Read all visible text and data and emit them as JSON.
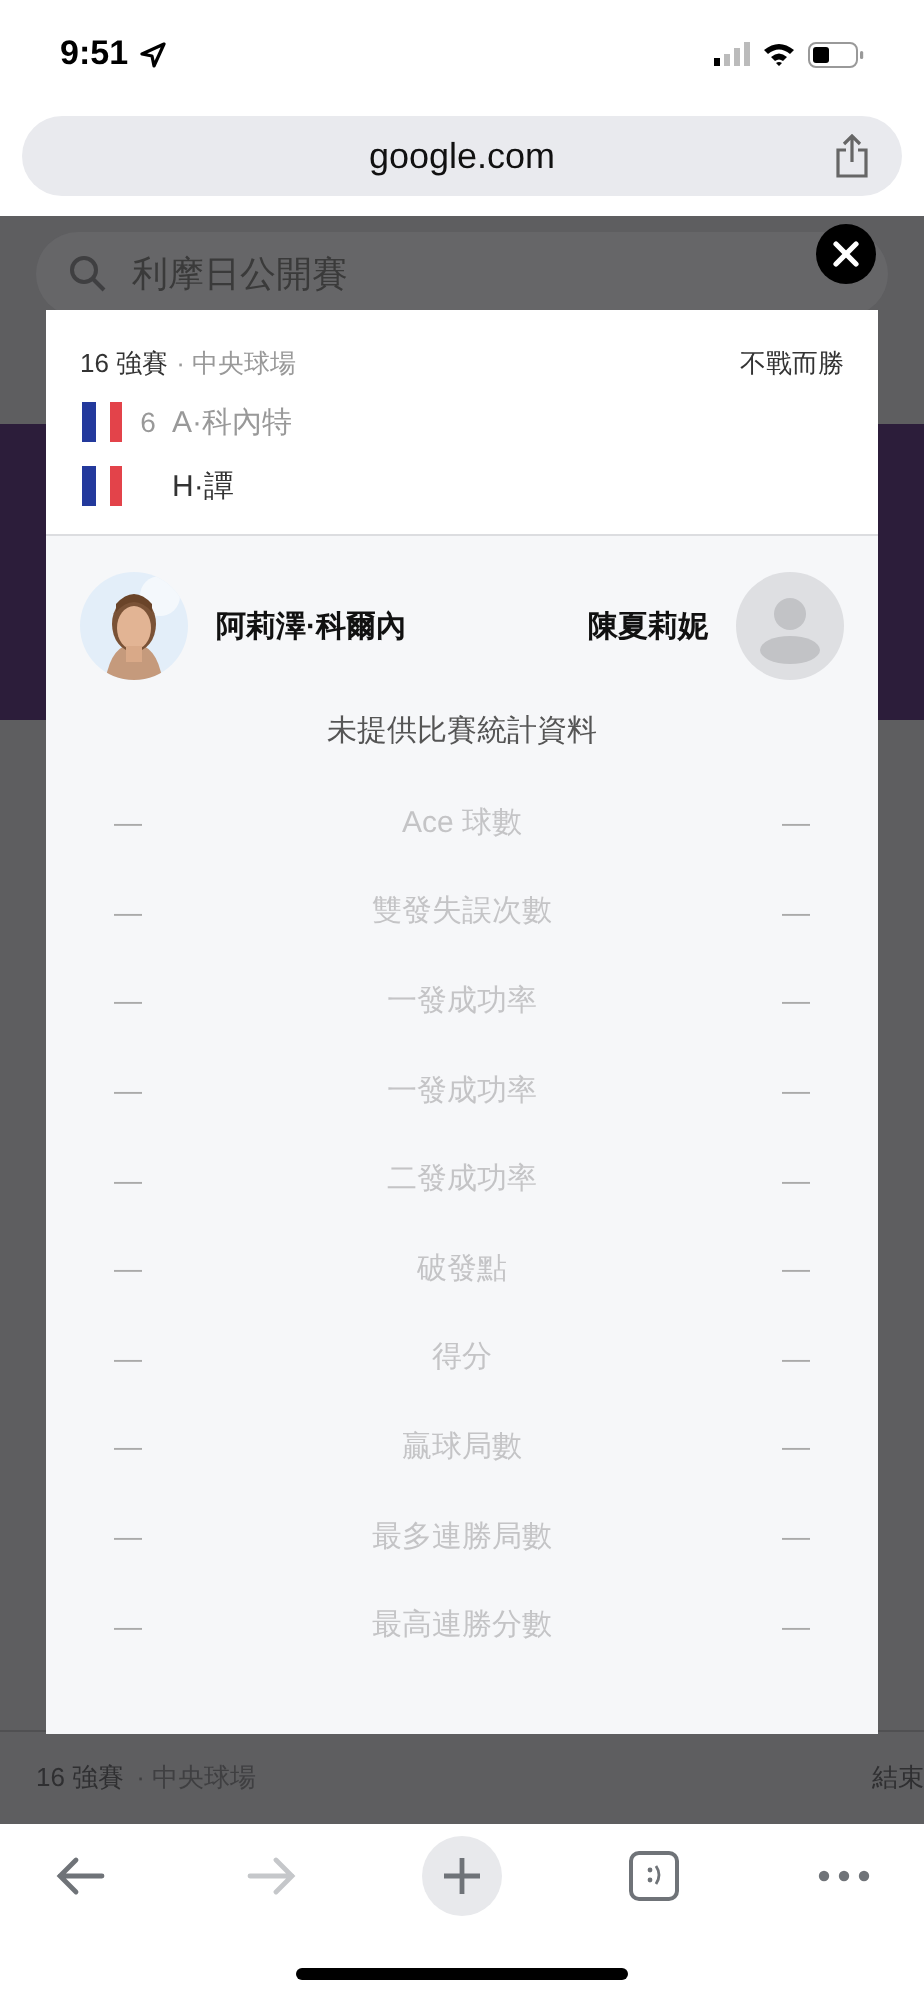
{
  "status_bar": {
    "time": "9:51"
  },
  "browser": {
    "url": "google.com"
  },
  "page": {
    "search_query": "利摩日公開賽",
    "bottom_match": {
      "round": "16 強賽",
      "court": "· 中央球場",
      "status": "結束"
    }
  },
  "dialog": {
    "round": "16 強賽",
    "court": "· 中央球場",
    "result": "不戰而勝",
    "teams": [
      {
        "seed": "6",
        "name": "A·科內特",
        "winner": false
      },
      {
        "name": "H·譚",
        "winner": true
      }
    ],
    "players": [
      {
        "name": "阿莉澤·科爾內",
        "kind": "picture"
      },
      {
        "name": "陳夏莉妮",
        "kind": "placeholder"
      }
    ],
    "no_stats_note": "未提供比賽統計資料",
    "stats": [
      {
        "left": "—",
        "label": "Ace 球數",
        "right": "—"
      },
      {
        "left": "—",
        "label": "雙發失誤次數",
        "right": "—"
      },
      {
        "left": "—",
        "label": "一發成功率",
        "right": "—"
      },
      {
        "left": "—",
        "label": "一發成功率",
        "right": "—"
      },
      {
        "left": "—",
        "label": "二發成功率",
        "right": "—"
      },
      {
        "left": "—",
        "label": "破發點",
        "right": "—"
      },
      {
        "left": "—",
        "label": "得分",
        "right": "—"
      },
      {
        "left": "—",
        "label": "贏球局數",
        "right": "—"
      },
      {
        "left": "—",
        "label": "最多連勝局數",
        "right": "—"
      },
      {
        "left": "—",
        "label": "最高連勝分數",
        "right": "—"
      }
    ]
  }
}
